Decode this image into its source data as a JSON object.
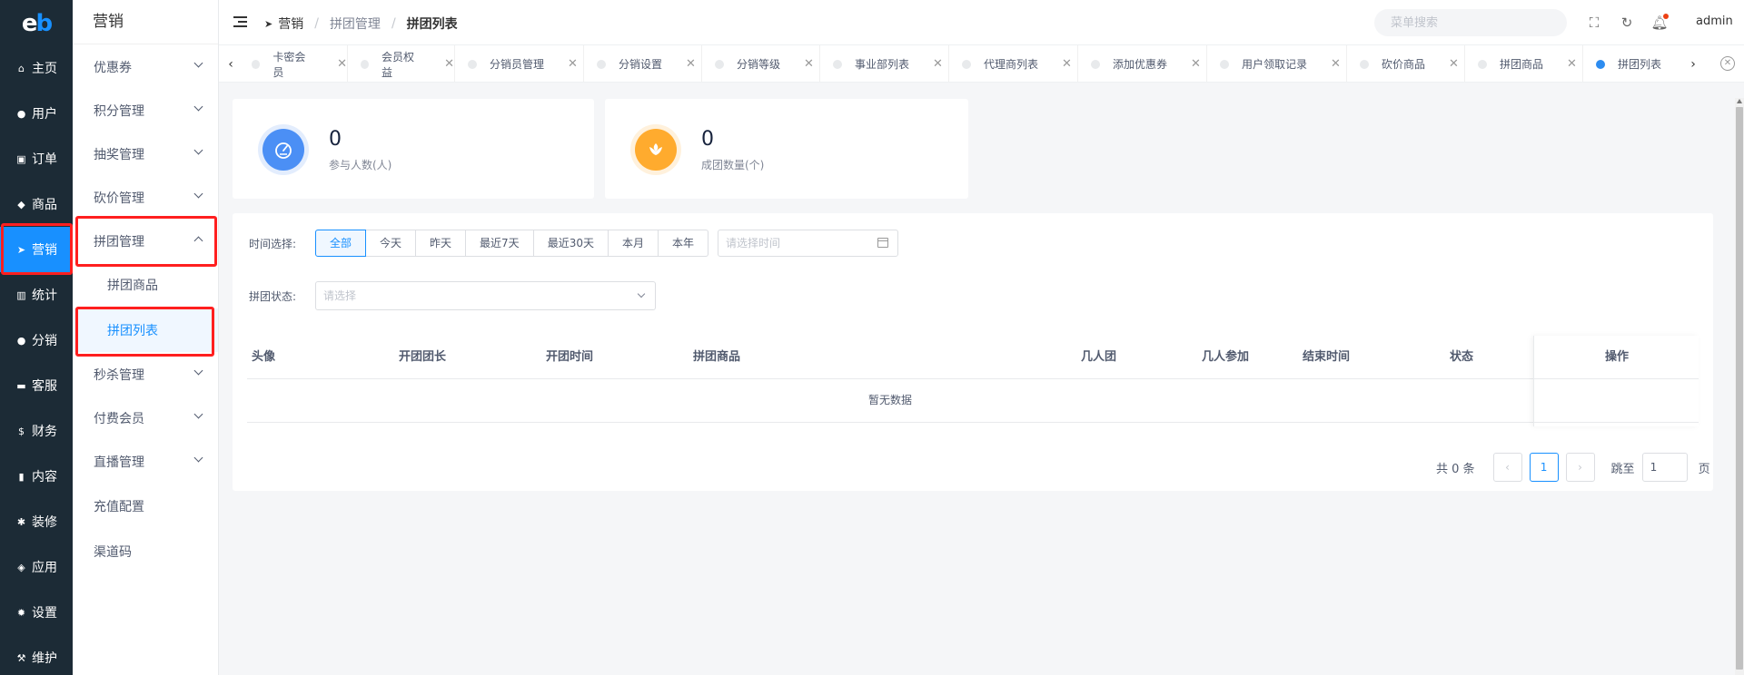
{
  "logo": {
    "left": "e",
    "right": "b"
  },
  "rail": [
    {
      "label": "主页",
      "icon": "home-icon",
      "glyph": "⌂"
    },
    {
      "label": "用户",
      "icon": "user-icon",
      "glyph": "●"
    },
    {
      "label": "订单",
      "icon": "cart-icon",
      "glyph": "▣"
    },
    {
      "label": "商品",
      "icon": "bag-icon",
      "glyph": "◆"
    },
    {
      "label": "营销",
      "icon": "send-icon",
      "glyph": "➤"
    },
    {
      "label": "统计",
      "icon": "chart-icon",
      "glyph": "▥"
    },
    {
      "label": "分销",
      "icon": "group-icon",
      "glyph": "●"
    },
    {
      "label": "客服",
      "icon": "chat-icon",
      "glyph": "▬"
    },
    {
      "label": "财务",
      "icon": "dollar-icon",
      "glyph": "$"
    },
    {
      "label": "内容",
      "icon": "book-icon",
      "glyph": "▮"
    },
    {
      "label": "装修",
      "icon": "tools-icon",
      "glyph": "✱"
    },
    {
      "label": "应用",
      "icon": "cube-icon",
      "glyph": "◈"
    },
    {
      "label": "设置",
      "icon": "gear-icon",
      "glyph": "✹"
    },
    {
      "label": "维护",
      "icon": "hammer-icon",
      "glyph": "⚒"
    }
  ],
  "submenu": {
    "title": "营销",
    "items": [
      {
        "label": "优惠券"
      },
      {
        "label": "积分管理"
      },
      {
        "label": "抽奖管理"
      },
      {
        "label": "砍价管理"
      },
      {
        "label": "拼团管理"
      },
      {
        "label": "拼团商品"
      },
      {
        "label": "拼团列表"
      },
      {
        "label": "秒杀管理"
      },
      {
        "label": "付费会员"
      },
      {
        "label": "直播管理"
      },
      {
        "label": "充值配置"
      },
      {
        "label": "渠道码"
      }
    ]
  },
  "breadcrumb": {
    "root": "营销",
    "parent": "拼团管理",
    "current": "拼团列表"
  },
  "header": {
    "search_placeholder": "菜单搜索",
    "user": "admin"
  },
  "tabs": [
    "卡密会员",
    "会员权益",
    "分销员管理",
    "分销设置",
    "分销等级",
    "事业部列表",
    "代理商列表",
    "添加优惠券",
    "用户领取记录",
    "砍价商品",
    "拼团商品",
    "拼团列表"
  ],
  "stats": [
    {
      "value": "0",
      "label": "参与人数(人)",
      "color": "#4b8ff5"
    },
    {
      "value": "0",
      "label": "成团数量(个)",
      "color": "#ffab2e"
    }
  ],
  "filters": {
    "time_label": "时间选择:",
    "time_options": [
      "全部",
      "今天",
      "昨天",
      "最近7天",
      "最近30天",
      "本月",
      "本年"
    ],
    "date_placeholder": "请选择时间",
    "status_label": "拼团状态:",
    "status_placeholder": "请选择"
  },
  "table": {
    "columns": [
      "头像",
      "开团团长",
      "开团时间",
      "拼团商品",
      "几人团",
      "几人参加",
      "结束时间",
      "状态"
    ],
    "op_column": "操作",
    "empty_text": "暂无数据"
  },
  "pagination": {
    "total": "共 0 条",
    "current": "1",
    "jump_label": "跳至",
    "jump_value": "1",
    "page_suffix": "页"
  },
  "colors": {
    "accent": "#1890ff",
    "highlight": "#ff1f1f",
    "rail_bg": "#1c2b36"
  }
}
